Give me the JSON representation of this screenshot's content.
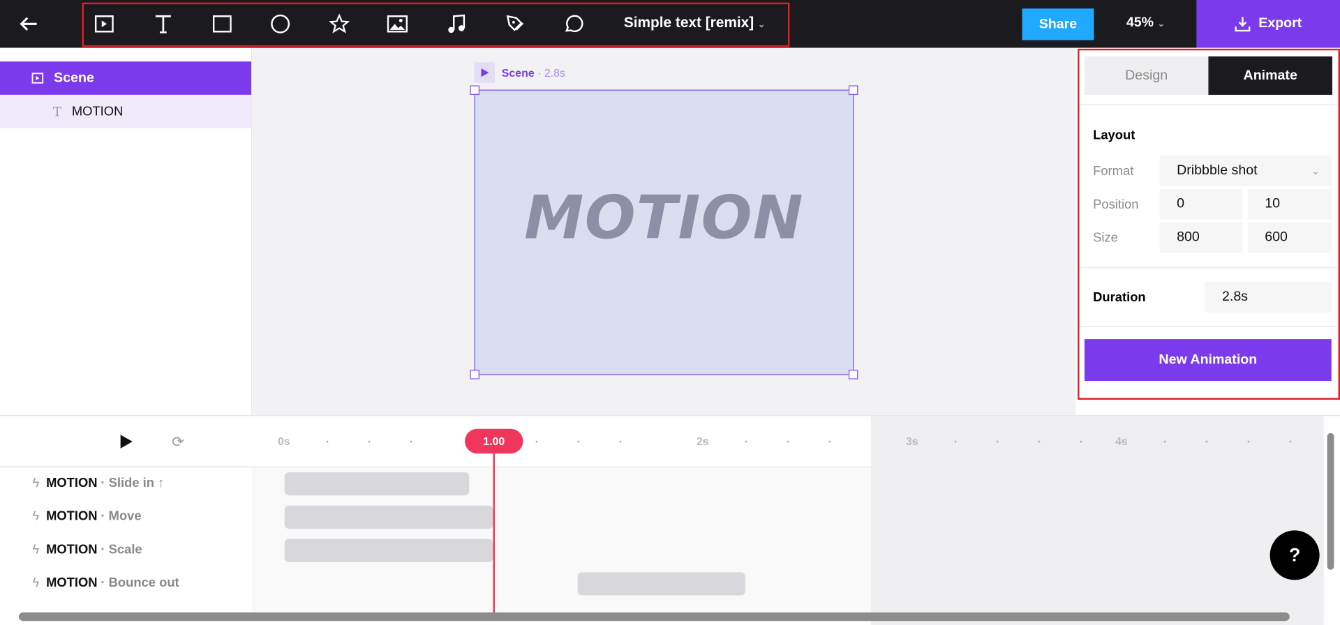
{
  "topbar": {
    "title": "Simple text [remix]",
    "share": "Share",
    "zoom": "45%",
    "export": "Export",
    "tools": [
      "scene-icon",
      "text-icon",
      "rectangle-icon",
      "circle-icon",
      "star-icon",
      "image-icon",
      "music-icon",
      "pen-icon",
      "speech-bubble-icon"
    ]
  },
  "layers": {
    "scene": "Scene",
    "motion": "MOTION"
  },
  "canvas": {
    "scene_label": "Scene",
    "scene_duration": "· 2.8s",
    "text": "MOTION"
  },
  "panel": {
    "tabs": [
      "Design",
      "Animate"
    ],
    "layout": "Layout",
    "format_label": "Format",
    "format_value": "Dribbble shot",
    "position_label": "Position",
    "pos_x": "0",
    "pos_y": "10",
    "size_label": "Size",
    "width": "800",
    "height": "600",
    "duration_label": "Duration",
    "duration": "2.8s",
    "new_animation": "New Animation"
  },
  "timeline": {
    "playhead": "1.00",
    "ticks": [
      "0s",
      "2s",
      "3s",
      "4s"
    ],
    "tracks": [
      {
        "name": "MOTION",
        "anim": "· Slide in ↑"
      },
      {
        "name": "MOTION",
        "anim": "· Move"
      },
      {
        "name": "MOTION",
        "anim": "· Scale"
      },
      {
        "name": "MOTION",
        "anim": "· Bounce out"
      }
    ]
  },
  "help": "?"
}
